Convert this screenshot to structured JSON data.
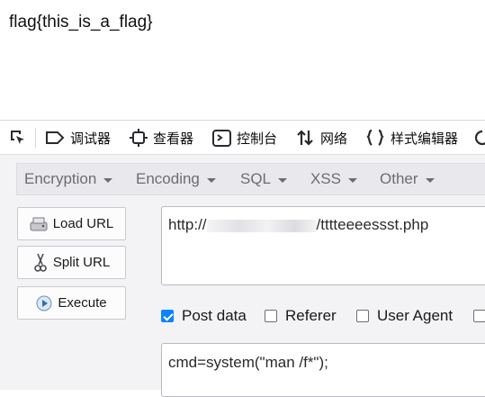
{
  "page": {
    "output_text": "flag{this_is_a_flag}"
  },
  "devtools": {
    "inspector_label": "调试器",
    "console_label": "查看器",
    "debugger_label": "控制台",
    "network_label": "网络",
    "style_editor_label": "样式编辑器"
  },
  "hackbar": {
    "menu": [
      "Encryption",
      "Encoding",
      "SQL",
      "XSS",
      "Other"
    ],
    "buttons": {
      "load": "Load URL",
      "split": "Split URL",
      "execute": "Execute"
    },
    "url_prefix": "http://",
    "url_suffix": "/tttteeeessst.php",
    "options": {
      "post_data": "Post data",
      "referer": "Referer",
      "user_agent": "User Agent"
    },
    "post_data_checked": true,
    "post_body": "cmd=system(\"man /f*\");"
  }
}
